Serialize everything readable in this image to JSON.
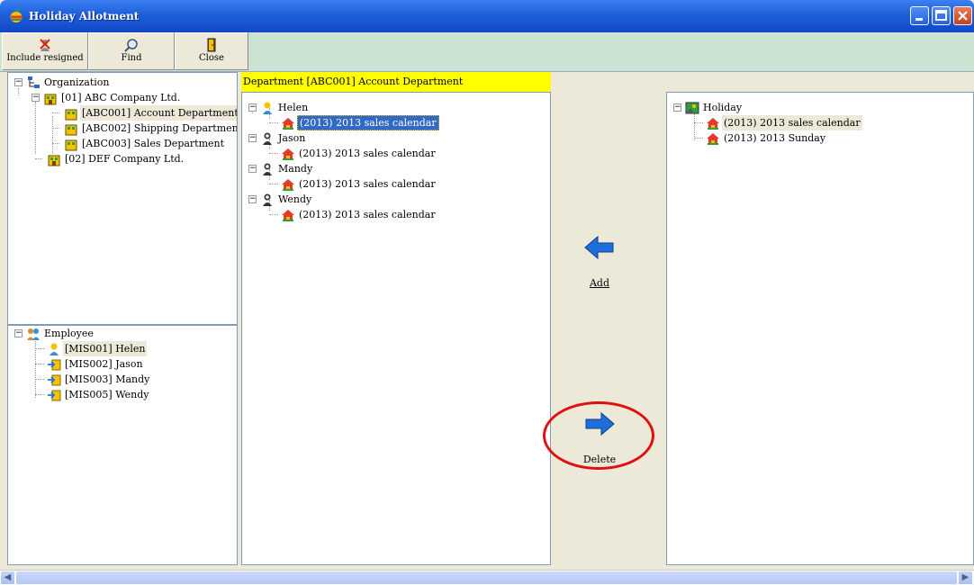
{
  "window": {
    "title": "Holiday Allotment"
  },
  "toolbar": {
    "include_resigned": "Include resigned",
    "find": "Find",
    "close": "Close"
  },
  "org_tree": {
    "root": "Organization",
    "companies": [
      {
        "label": "[01]  ABC Company Ltd.",
        "departments": [
          "[ABC001]  Account Department",
          "[ABC002]  Shipping Department",
          "[ABC003]  Sales Department"
        ]
      },
      {
        "label": "[02]  DEF Company Ltd.",
        "departments": []
      }
    ]
  },
  "employee_tree": {
    "root": "Employee",
    "items": [
      "[MIS001]  Helen",
      "[MIS002]  Jason",
      "[MIS003]  Mandy",
      "[MIS005]  Wendy"
    ]
  },
  "department_panel": {
    "header": "Department  [ABC001]  Account Department",
    "people": [
      {
        "name": "Helen",
        "calendar": "(2013)  2013 sales calendar"
      },
      {
        "name": "Jason",
        "calendar": "(2013)  2013 sales calendar"
      },
      {
        "name": "Mandy",
        "calendar": "(2013)  2013 sales calendar"
      },
      {
        "name": "Wendy",
        "calendar": "(2013)  2013 sales calendar"
      }
    ]
  },
  "actions": {
    "add": "Add",
    "delete": "Delete",
    "accent": "#1E6FD9",
    "annotation_color": "#E01010"
  },
  "holiday_tree": {
    "root": "Holiday",
    "items": [
      "(2013)  2013 sales calendar",
      "(2013)  2013 Sunday"
    ]
  }
}
